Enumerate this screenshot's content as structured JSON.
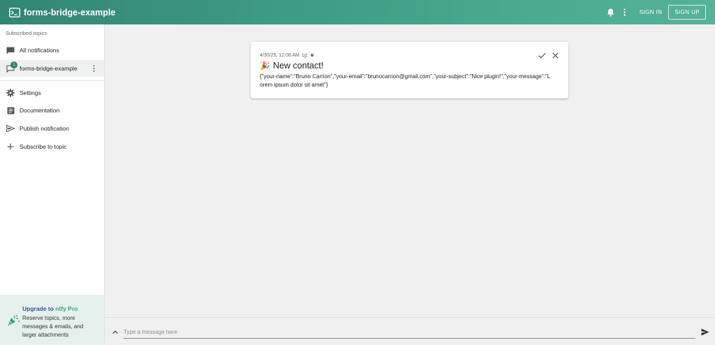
{
  "app": {
    "title": "forms-bridge-example",
    "sign_in": "SIGN IN",
    "sign_up": "SIGN UP"
  },
  "sidebar": {
    "subheader": "Subscribed topics",
    "all_notifications": "All notifications",
    "topic": {
      "label": "forms-bridge-example",
      "badge": "1"
    },
    "items": [
      {
        "label": "Settings",
        "icon": "gear-icon"
      },
      {
        "label": "Documentation",
        "icon": "article-icon"
      },
      {
        "label": "Publish notification",
        "icon": "send-icon"
      },
      {
        "label": "Subscribe to topic",
        "icon": "plus-icon"
      }
    ],
    "upgrade": {
      "prefix": "Upgrade to ",
      "brand": "ntfy Pro",
      "description": "Reserve topics, more messages & emails, and larger attachments"
    }
  },
  "notification": {
    "timestamp": "4/30/25, 12:08 AM",
    "emoji": "🎉",
    "title": "New contact!",
    "message": "{\"your-name\":\"Bruno Carrion\",\"your-email\":\"brunocarrion@gmail.com\",\"your-subject\":\"Nice plugin!\",\"your-message\":\"Lorem ipsum dolor sit amet\"}"
  },
  "composer": {
    "placeholder": "Type a message here"
  },
  "colors": {
    "primary": "#338574",
    "accent": "#56b29b",
    "brand_blue": "#3a4c9b",
    "brand_green": "#3aa17a"
  }
}
